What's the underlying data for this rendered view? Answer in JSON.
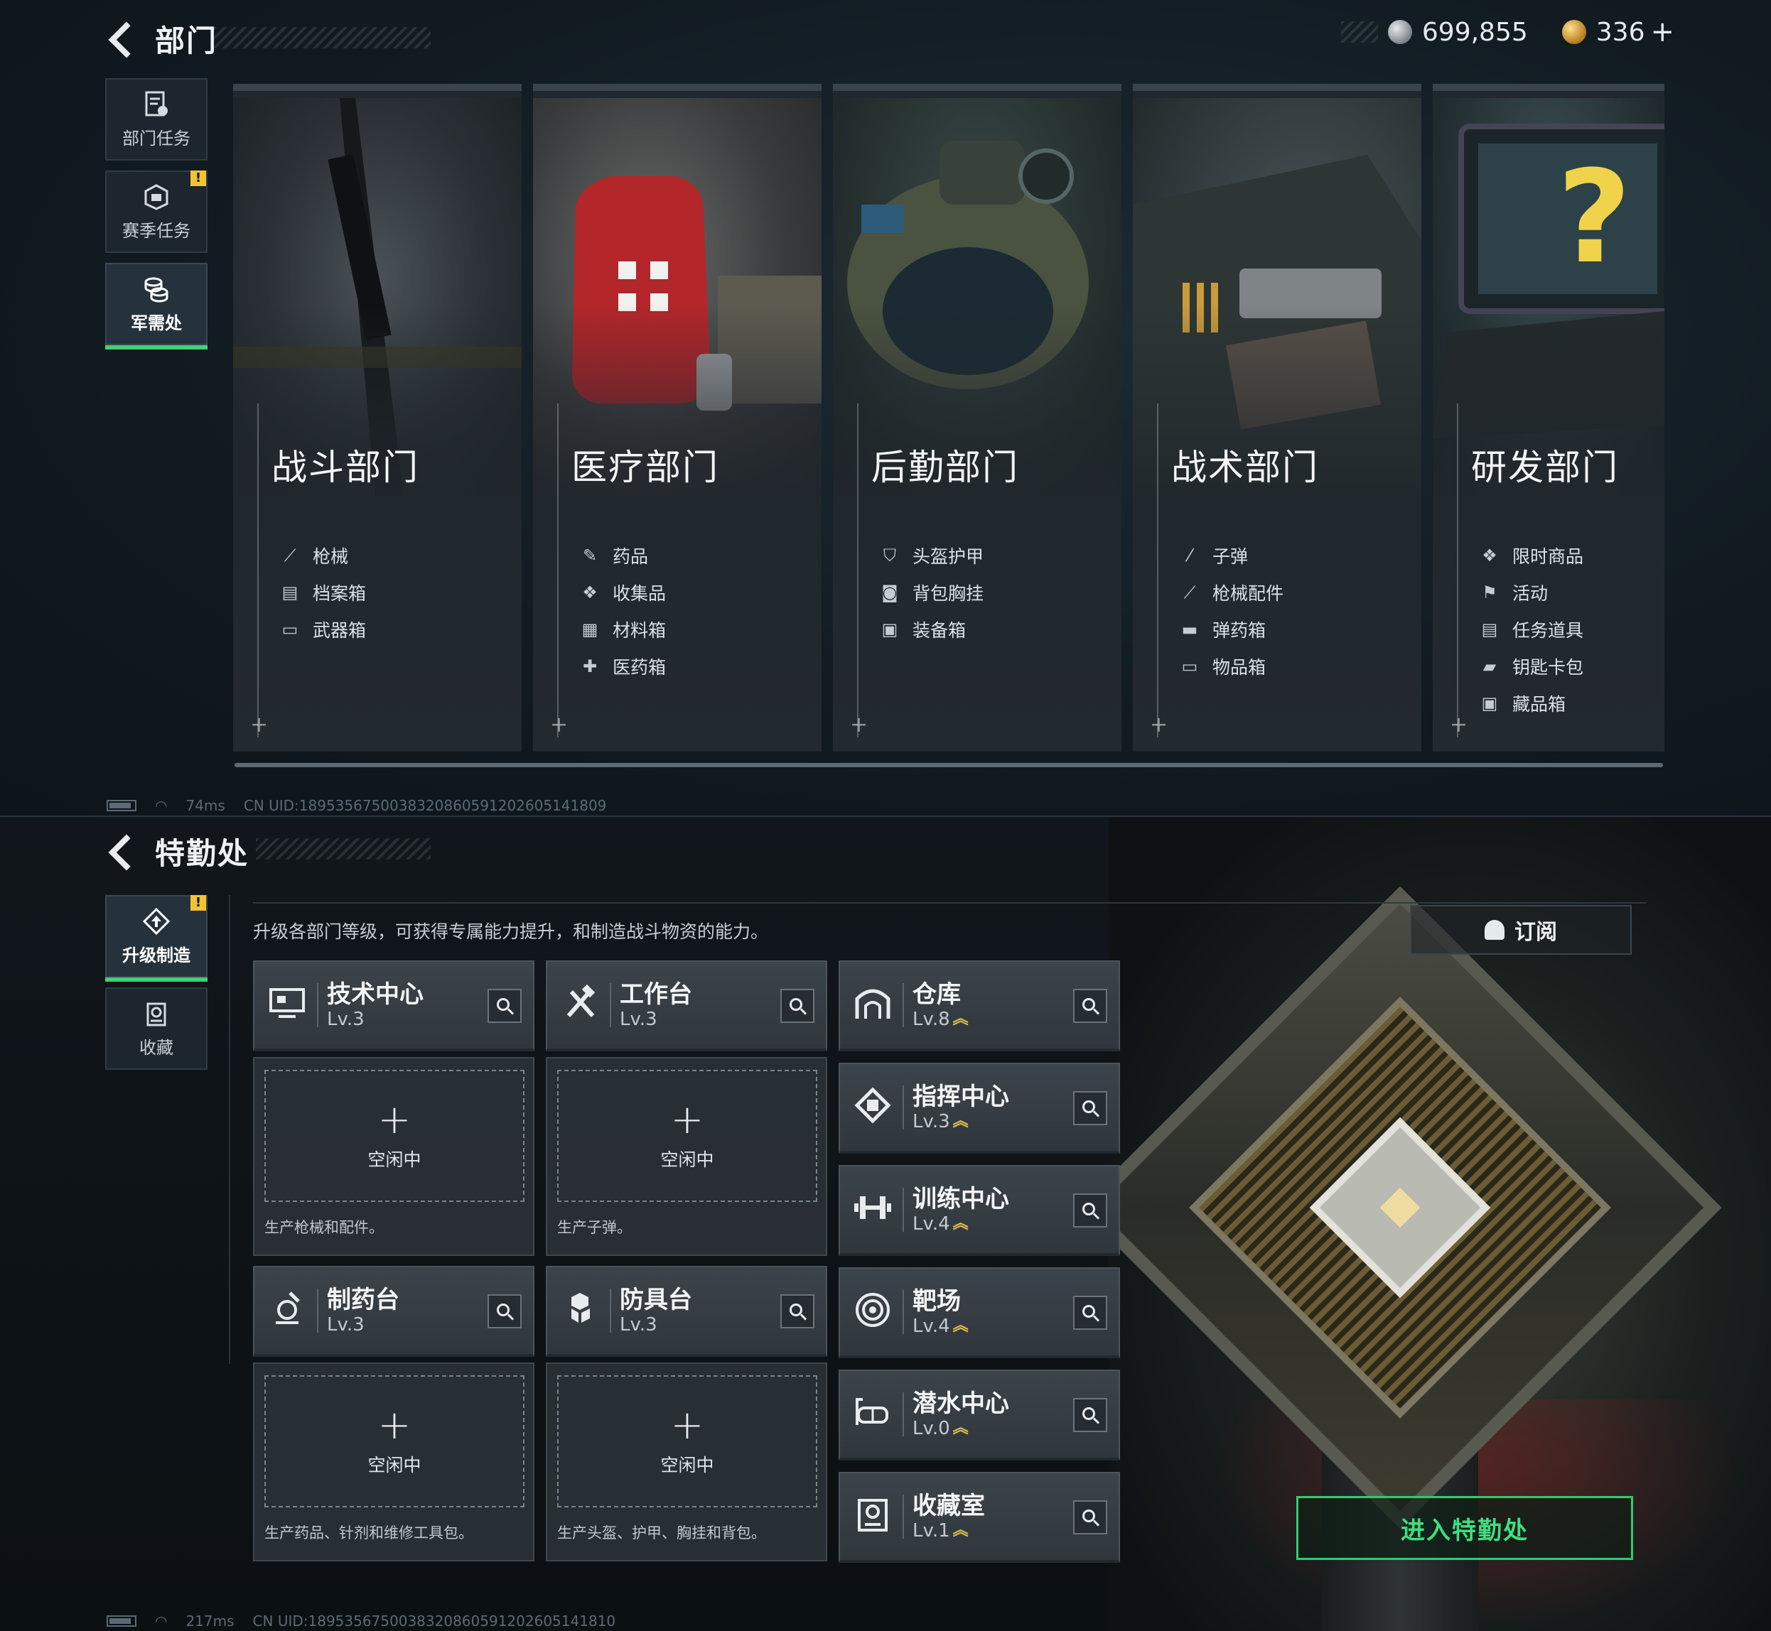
{
  "top": {
    "title": "部门",
    "currency": {
      "silver": "699,855",
      "gold": "336",
      "gold_plus": "+"
    },
    "nav": [
      {
        "label": "部门任务",
        "icon": "task-doc-icon"
      },
      {
        "label": "赛季任务",
        "icon": "season-box-icon",
        "badge": "!"
      },
      {
        "label": "军需处",
        "icon": "coin-stack-icon",
        "active": true
      }
    ],
    "departments": [
      {
        "name": "战斗部门",
        "items": [
          {
            "label": "枪械",
            "icon": "rifle-icon"
          },
          {
            "label": "档案箱",
            "icon": "file-box-icon"
          },
          {
            "label": "武器箱",
            "icon": "weapon-case-icon"
          }
        ]
      },
      {
        "name": "医疗部门",
        "items": [
          {
            "label": "药品",
            "icon": "syringe-icon"
          },
          {
            "label": "收集品",
            "icon": "collectible-icon"
          },
          {
            "label": "材料箱",
            "icon": "material-box-icon"
          },
          {
            "label": "医药箱",
            "icon": "medkit-icon"
          }
        ]
      },
      {
        "name": "后勤部门",
        "items": [
          {
            "label": "头盔护甲",
            "icon": "armor-icon"
          },
          {
            "label": "背包胸挂",
            "icon": "backpack-icon"
          },
          {
            "label": "装备箱",
            "icon": "gear-box-icon"
          }
        ]
      },
      {
        "name": "战术部门",
        "items": [
          {
            "label": "子弹",
            "icon": "bullet-icon"
          },
          {
            "label": "枪械配件",
            "icon": "attachment-icon"
          },
          {
            "label": "弹药箱",
            "icon": "ammo-box-icon"
          },
          {
            "label": "物品箱",
            "icon": "item-box-icon"
          }
        ]
      },
      {
        "name": "研发部门",
        "items": [
          {
            "label": "限时商品",
            "icon": "limited-item-icon"
          },
          {
            "label": "活动",
            "icon": "event-icon"
          },
          {
            "label": "任务道具",
            "icon": "quest-item-icon"
          },
          {
            "label": "钥匙卡包",
            "icon": "keycard-icon"
          },
          {
            "label": "藏品箱",
            "icon": "collection-box-icon"
          }
        ]
      }
    ],
    "status": {
      "ping": "74ms",
      "uid": "CN UID:1895356750038320860591202605141809"
    }
  },
  "bottom": {
    "title": "特勤处",
    "nav": [
      {
        "label": "升级制造",
        "icon": "upgrade-icon",
        "badge": "!",
        "active": true
      },
      {
        "label": "收藏",
        "icon": "collection-icon"
      }
    ],
    "description": "升级各部门等级，可获得专属能力提升，和制造战斗物资的能力。",
    "subscribe_label": "订阅",
    "production": [
      {
        "name": "技术中心",
        "level": "Lv.3",
        "icon": "monitor-icon",
        "slot_status": "空闲中",
        "slot_desc": "生产枪械和配件。"
      },
      {
        "name": "工作台",
        "level": "Lv.3",
        "icon": "tools-icon",
        "slot_status": "空闲中",
        "slot_desc": "生产子弹。"
      },
      {
        "name": "制药台",
        "level": "Lv.3",
        "icon": "pharmacy-icon",
        "slot_status": "空闲中",
        "slot_desc": "生产药品、针剂和维修工具包。"
      },
      {
        "name": "防具台",
        "level": "Lv.3",
        "icon": "armor-bench-icon",
        "slot_status": "空闲中",
        "slot_desc": "生产头盔、护甲、胸挂和背包。"
      }
    ],
    "facilities": [
      {
        "name": "仓库",
        "level": "Lv.8",
        "icon": "warehouse-icon",
        "upgradable": true
      },
      {
        "name": "指挥中心",
        "level": "Lv.3",
        "icon": "command-chip-icon",
        "upgradable": true
      },
      {
        "name": "训练中心",
        "level": "Lv.4",
        "icon": "dumbbell-icon",
        "upgradable": true
      },
      {
        "name": "靶场",
        "level": "Lv.4",
        "icon": "target-icon",
        "upgradable": true
      },
      {
        "name": "潜水中心",
        "level": "Lv.0",
        "icon": "diving-mask-icon",
        "upgradable": true
      },
      {
        "name": "收藏室",
        "level": "Lv.1",
        "icon": "trophy-room-icon",
        "upgradable": true
      }
    ],
    "slot_plus": "+",
    "up_arrows": "︽",
    "enter_label": "进入特勤处",
    "status": {
      "ping": "217ms",
      "uid": "CN UID:1895356750038320860591202605141810"
    }
  }
}
